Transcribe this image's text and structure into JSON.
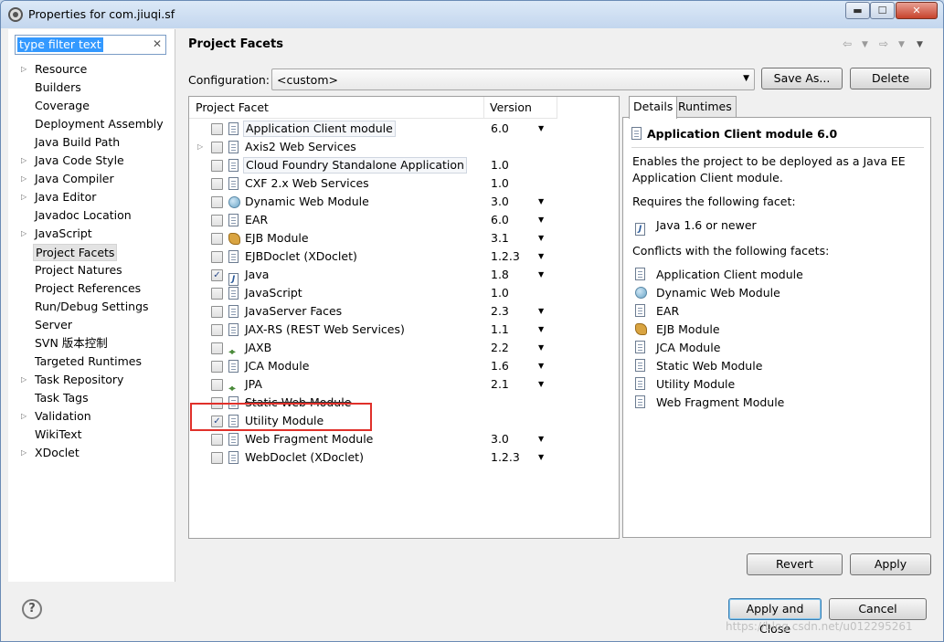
{
  "window": {
    "title": "Properties for com.jiuqi.sf",
    "min": "▬",
    "max": "☐",
    "close": "✕"
  },
  "filter": {
    "text": "type filter text",
    "clear": "✕"
  },
  "tree": [
    {
      "label": "Resource",
      "arrow": true
    },
    {
      "label": "Builders",
      "arrow": false
    },
    {
      "label": "Coverage",
      "arrow": false
    },
    {
      "label": "Deployment Assembly",
      "arrow": false
    },
    {
      "label": "Java Build Path",
      "arrow": false
    },
    {
      "label": "Java Code Style",
      "arrow": true
    },
    {
      "label": "Java Compiler",
      "arrow": true
    },
    {
      "label": "Java Editor",
      "arrow": true
    },
    {
      "label": "Javadoc Location",
      "arrow": false
    },
    {
      "label": "JavaScript",
      "arrow": true
    },
    {
      "label": "Project Facets",
      "arrow": false,
      "selected": true
    },
    {
      "label": "Project Natures",
      "arrow": false
    },
    {
      "label": "Project References",
      "arrow": false
    },
    {
      "label": "Run/Debug Settings",
      "arrow": false
    },
    {
      "label": "Server",
      "arrow": false
    },
    {
      "label": "SVN 版本控制",
      "arrow": false
    },
    {
      "label": "Targeted Runtimes",
      "arrow": false
    },
    {
      "label": "Task Repository",
      "arrow": true
    },
    {
      "label": "Task Tags",
      "arrow": false
    },
    {
      "label": "Validation",
      "arrow": true
    },
    {
      "label": "WikiText",
      "arrow": false
    },
    {
      "label": "XDoclet",
      "arrow": true
    }
  ],
  "page": {
    "title": "Project Facets",
    "configuration_label": "Configuration:",
    "configuration_value": "<custom>",
    "save_as": "Save As...",
    "delete": "Delete"
  },
  "table": {
    "col_facet": "Project Facet",
    "col_version": "Version",
    "rows": [
      {
        "name": "Application Client module",
        "version": "6.0",
        "dd": true,
        "checked": false,
        "icon": "doc",
        "boxed": true
      },
      {
        "name": "Axis2 Web Services",
        "version": "",
        "dd": false,
        "checked": false,
        "icon": "doc",
        "expander": true
      },
      {
        "name": "Cloud Foundry Standalone Application",
        "version": "1.0",
        "dd": false,
        "checked": false,
        "icon": "doc",
        "boxed": true
      },
      {
        "name": "CXF 2.x Web Services",
        "version": "1.0",
        "dd": false,
        "checked": false,
        "icon": "doc"
      },
      {
        "name": "Dynamic Web Module",
        "version": "3.0",
        "dd": true,
        "checked": false,
        "icon": "globe"
      },
      {
        "name": "EAR",
        "version": "6.0",
        "dd": true,
        "checked": false,
        "icon": "doc"
      },
      {
        "name": "EJB Module",
        "version": "3.1",
        "dd": true,
        "checked": false,
        "icon": "bean"
      },
      {
        "name": "EJBDoclet (XDoclet)",
        "version": "1.2.3",
        "dd": true,
        "checked": false,
        "icon": "doc"
      },
      {
        "name": "Java",
        "version": "1.8",
        "dd": true,
        "checked": true,
        "icon": "java"
      },
      {
        "name": "JavaScript",
        "version": "1.0",
        "dd": false,
        "checked": false,
        "icon": "doc"
      },
      {
        "name": "JavaServer Faces",
        "version": "2.3",
        "dd": true,
        "checked": false,
        "icon": "doc"
      },
      {
        "name": "JAX-RS (REST Web Services)",
        "version": "1.1",
        "dd": true,
        "checked": false,
        "icon": "doc"
      },
      {
        "name": "JAXB",
        "version": "2.2",
        "dd": true,
        "checked": false,
        "icon": "arrows"
      },
      {
        "name": "JCA Module",
        "version": "1.6",
        "dd": true,
        "checked": false,
        "icon": "doc"
      },
      {
        "name": "JPA",
        "version": "2.1",
        "dd": true,
        "checked": false,
        "icon": "arrows"
      },
      {
        "name": "Static Web Module",
        "version": "",
        "dd": false,
        "checked": false,
        "icon": "doc",
        "strike": true
      },
      {
        "name": "Utility Module",
        "version": "",
        "dd": false,
        "checked": true,
        "icon": "doc"
      },
      {
        "name": "Web Fragment Module",
        "version": "3.0",
        "dd": true,
        "checked": false,
        "icon": "doc"
      },
      {
        "name": "WebDoclet (XDoclet)",
        "version": "1.2.3",
        "dd": true,
        "checked": false,
        "icon": "doc"
      }
    ]
  },
  "details": {
    "tab_details": "Details",
    "tab_runtimes": "Runtimes",
    "title": "Application Client module 6.0",
    "description": "Enables the project to be deployed as a Java EE Application Client module.",
    "requires_label": "Requires the following facet:",
    "requires": [
      {
        "label": "Java 1.6 or newer",
        "icon": "java"
      }
    ],
    "conflicts_label": "Conflicts with the following facets:",
    "conflicts": [
      {
        "label": "Application Client module",
        "icon": "doc"
      },
      {
        "label": "Dynamic Web Module",
        "icon": "globe"
      },
      {
        "label": "EAR",
        "icon": "doc"
      },
      {
        "label": "EJB Module",
        "icon": "bean"
      },
      {
        "label": "JCA Module",
        "icon": "doc"
      },
      {
        "label": "Static Web Module",
        "icon": "doc"
      },
      {
        "label": "Utility Module",
        "icon": "doc"
      },
      {
        "label": "Web Fragment Module",
        "icon": "doc"
      }
    ]
  },
  "buttons": {
    "revert": "Revert",
    "apply": "Apply",
    "apply_close": "Apply and Close",
    "cancel": "Cancel",
    "help": "?"
  },
  "watermark": "https://blog.csdn.net/u012295261",
  "colors": {
    "highlight_box": "#e0302a",
    "selection": "#3399ff"
  }
}
